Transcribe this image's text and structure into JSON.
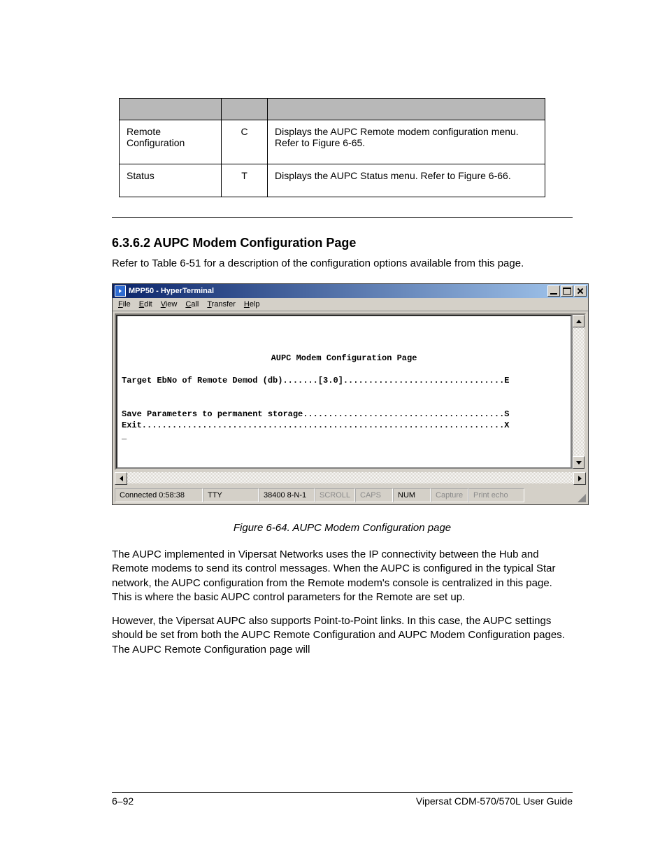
{
  "table": {
    "rows": [
      {
        "c1": "Remote Configuration",
        "c2": "C",
        "c3": "Displays the AUPC Remote modem configuration menu. Refer to Figure 6-65."
      },
      {
        "c1": "Status",
        "c2": "T",
        "c3": "Displays the AUPC Status menu. Refer to Figure 6-66."
      }
    ]
  },
  "heading": "6.3.6.2  AUPC Modem Configuration Page",
  "intro": "Refer to Table 6-51 for a description of the configuration options available from this page.",
  "window": {
    "title": "MPP50 - HyperTerminal",
    "menus": [
      "File",
      "Edit",
      "View",
      "Call",
      "Transfer",
      "Help"
    ],
    "status": {
      "conn": "Connected 0:58:38",
      "mode": "TTY",
      "fmt": "38400 8-N-1",
      "scroll": "SCROLL",
      "caps": "CAPS",
      "num": "NUM",
      "capture": "Capture",
      "echo": "Print echo"
    }
  },
  "terminal": {
    "title": "AUPC Modem Configuration Page",
    "line1": "Target EbNo of Remote Demod (db).......[3.0]................................E",
    "line2": "Save Parameters to permanent storage........................................S",
    "line3": "Exit........................................................................X",
    "cursor": "_"
  },
  "figcap": "Figure 6-64. AUPC Modem Configuration page",
  "body_p1": "The AUPC implemented in Vipersat Networks uses the IP connectivity between the Hub and Remote modems to send its control messages. When the AUPC is configured in the typical Star network, the AUPC configuration from the Remote modem's console is centralized in this page. This is where the basic AUPC control parameters for the Remote are set up.",
  "body_p2": "However, the Vipersat AUPC also supports Point-to-Point links. In this case, the AUPC settings should be set from both the AUPC Remote Configuration and AUPC Modem Configuration pages. The AUPC Remote Configuration page will",
  "footer": {
    "left": "6–92",
    "right": "Vipersat CDM-570/570L User Guide"
  }
}
